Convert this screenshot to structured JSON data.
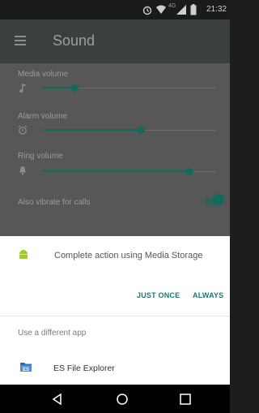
{
  "status_bar": {
    "time": "21:32",
    "network": "4G",
    "icons": [
      "alarm-icon",
      "wifi-icon",
      "signal-icon",
      "battery-icon"
    ]
  },
  "toolbar": {
    "title": "Sound",
    "menu_icon": "menu-icon"
  },
  "settings": {
    "media": {
      "label": "Media volume",
      "icon": "music-note-icon",
      "level": 0.18
    },
    "alarm": {
      "label": "Alarm volume",
      "icon": "alarm-clock-icon",
      "level": 0.56
    },
    "ring": {
      "label": "Ring volume",
      "icon": "bell-icon",
      "level": 0.92
    },
    "vibrate": {
      "label": "Also vibrate for calls",
      "enabled": true
    }
  },
  "sheet": {
    "title": "Complete action using Media Storage",
    "just_once": "JUST ONCE",
    "always": "ALWAYS",
    "different_app": "Use a different app",
    "app_name": "ES File Explorer"
  },
  "navbar": {
    "icons": [
      "back-icon",
      "home-icon",
      "recents-icon"
    ]
  },
  "colors": {
    "accent": "#0f6b5b",
    "button": "#1b7a6d",
    "sheet_bg": "#ffffff",
    "toolbar_bg": "#3a403f"
  }
}
